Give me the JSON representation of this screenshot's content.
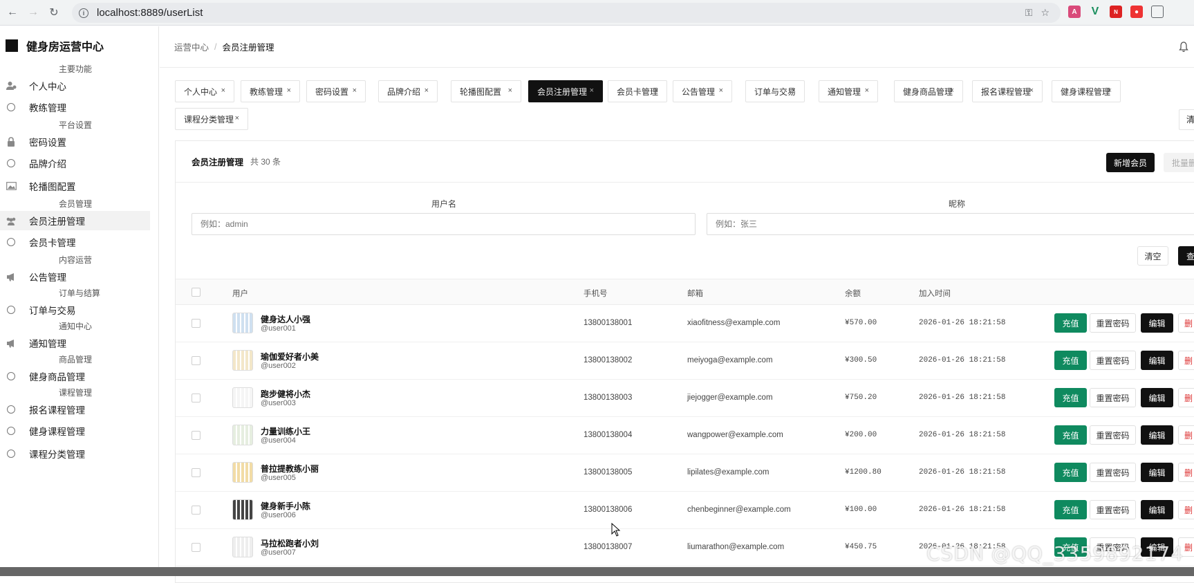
{
  "browser": {
    "url": "localhost:8889/userList"
  },
  "sidebar": {
    "brand": "健身房运营中心",
    "sections": [
      {
        "label": "主要功能",
        "items": [
          {
            "label": "个人中心",
            "icon": "user-icon"
          },
          {
            "label": "教练管理",
            "icon": "circle-icon"
          }
        ]
      },
      {
        "label": "平台设置",
        "items": [
          {
            "label": "密码设置",
            "icon": "lock-icon"
          },
          {
            "label": "品牌介绍",
            "icon": "circle-icon"
          },
          {
            "label": "轮播图配置",
            "icon": "image-icon"
          }
        ]
      },
      {
        "label": "会员管理",
        "items": [
          {
            "label": "会员注册管理",
            "icon": "users-icon",
            "active": true
          },
          {
            "label": "会员卡管理",
            "icon": "circle-icon"
          }
        ]
      },
      {
        "label": "内容运营",
        "items": [
          {
            "label": "公告管理",
            "icon": "megaphone-icon"
          }
        ]
      },
      {
        "label": "订单与结算",
        "items": [
          {
            "label": "订单与交易",
            "icon": "circle-icon"
          }
        ]
      },
      {
        "label": "通知中心",
        "items": [
          {
            "label": "通知管理",
            "icon": "megaphone-icon"
          }
        ]
      },
      {
        "label": "商品管理",
        "items": [
          {
            "label": "健身商品管理",
            "icon": "circle-icon"
          }
        ]
      },
      {
        "label": "课程管理",
        "items": [
          {
            "label": "报名课程管理",
            "icon": "circle-icon"
          },
          {
            "label": "健身课程管理",
            "icon": "circle-icon"
          },
          {
            "label": "课程分类管理",
            "icon": "circle-icon"
          }
        ]
      }
    ]
  },
  "breadcrumb": {
    "parent": "运营中心",
    "separator": "/",
    "current": "会员注册管理"
  },
  "tabs": [
    {
      "label": "个人中心"
    },
    {
      "label": "教练管理"
    },
    {
      "label": "密码设置"
    },
    {
      "label": "品牌介绍"
    },
    {
      "label": "轮播图配置"
    },
    {
      "label": "会员注册管理",
      "active": true
    },
    {
      "label": "会员卡管理"
    },
    {
      "label": "公告管理"
    },
    {
      "label": "订单与交易"
    },
    {
      "label": "通知管理"
    },
    {
      "label": "健身商品管理"
    },
    {
      "label": "报名课程管理"
    },
    {
      "label": "健身课程管理"
    },
    {
      "label": "课程分类管理"
    }
  ],
  "tab_close_glyph": "×",
  "clear_tabs_label": "清",
  "card": {
    "title": "会员注册管理",
    "count": "共 30 条",
    "add_button": "新增会员",
    "batch_delete_button": "批量删"
  },
  "filters": {
    "username_label": "用户名",
    "username_placeholder": "例如：admin",
    "nickname_label": "昵称",
    "nickname_placeholder": "例如：张三",
    "clear_button": "清空",
    "search_button": "查"
  },
  "table": {
    "columns": [
      "用户",
      "手机号",
      "邮箱",
      "余额",
      "加入时间"
    ],
    "actions": {
      "recharge": "充值",
      "reset_password": "重置密码",
      "edit": "编辑",
      "delete": "删"
    },
    "rows": [
      {
        "name": "健身达人小强",
        "handle": "@user001",
        "phone": "13800138001",
        "email": "xiaofitness@example.com",
        "balance": "¥570.00",
        "joined": "2026-01-26 18:21:58"
      },
      {
        "name": "瑜伽爱好者小美",
        "handle": "@user002",
        "phone": "13800138002",
        "email": "meiyoga@example.com",
        "balance": "¥300.50",
        "joined": "2026-01-26 18:21:58"
      },
      {
        "name": "跑步健将小杰",
        "handle": "@user003",
        "phone": "13800138003",
        "email": "jiejogger@example.com",
        "balance": "¥750.20",
        "joined": "2026-01-26 18:21:58"
      },
      {
        "name": "力量训练小王",
        "handle": "@user004",
        "phone": "13800138004",
        "email": "wangpower@example.com",
        "balance": "¥200.00",
        "joined": "2026-01-26 18:21:58"
      },
      {
        "name": "普拉提教练小丽",
        "handle": "@user005",
        "phone": "13800138005",
        "email": "lipilates@example.com",
        "balance": "¥1200.80",
        "joined": "2026-01-26 18:21:58"
      },
      {
        "name": "健身新手小陈",
        "handle": "@user006",
        "phone": "13800138006",
        "email": "chenbeginner@example.com",
        "balance": "¥100.00",
        "joined": "2026-01-26 18:21:58"
      },
      {
        "name": "马拉松跑者小刘",
        "handle": "@user007",
        "phone": "13800138007",
        "email": "liumarathon@example.com",
        "balance": "¥450.75",
        "joined": "2026-01-26 18:21:58"
      }
    ]
  },
  "watermark": "CSDN @QQ_3359892174",
  "colors": {
    "accent": "#111111",
    "recharge": "#0f8a5f",
    "delete": "#dd3333"
  }
}
